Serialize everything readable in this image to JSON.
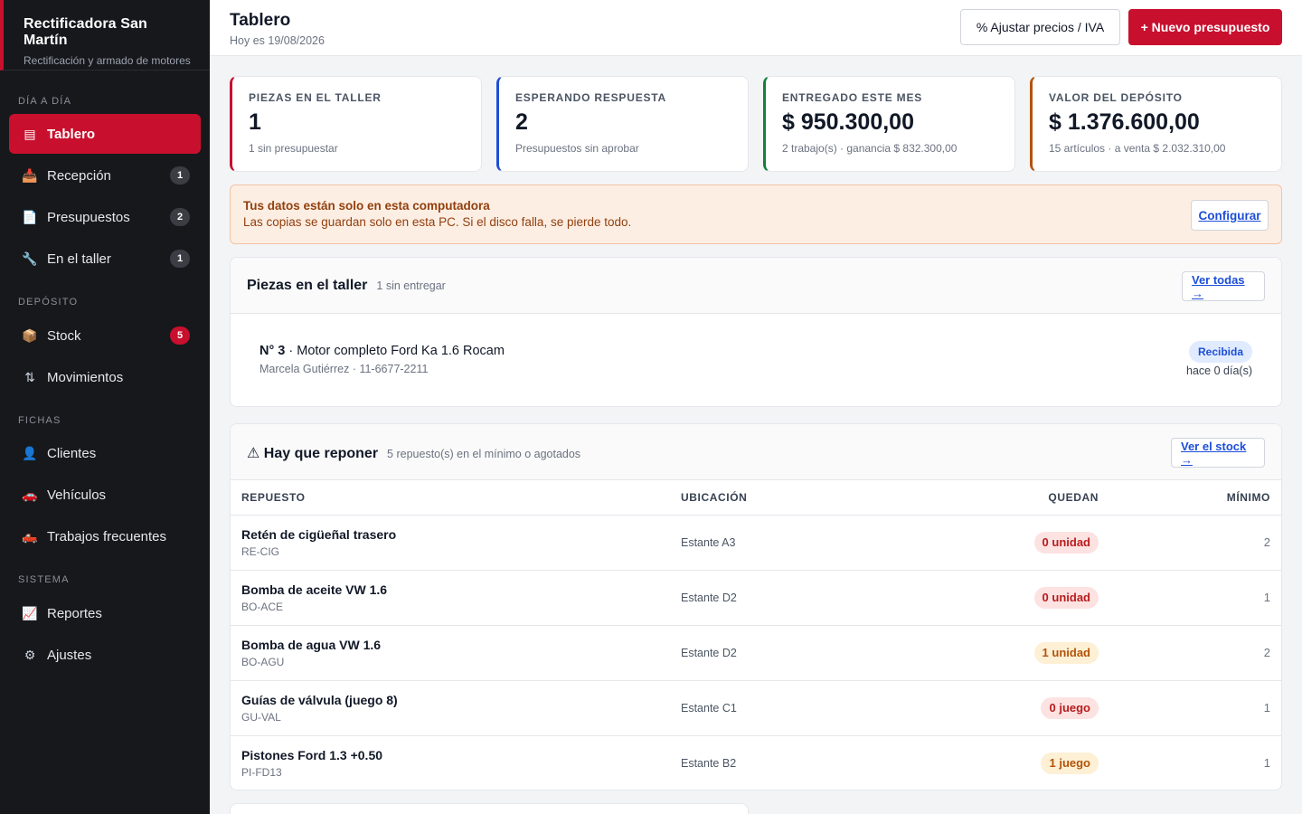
{
  "app": {
    "name": "Rectificadora San Martín",
    "tagline": "Rectificación y armado de motores"
  },
  "sidebar": {
    "sections": [
      {
        "label": "Día a día"
      },
      {
        "label": "Depósito"
      },
      {
        "label": "Fichas"
      },
      {
        "label": "Sistema"
      }
    ],
    "items": [
      {
        "label": "Tablero",
        "icon": "dashboard-icon",
        "glyph": "▤",
        "active": true
      },
      {
        "label": "Recepción",
        "icon": "inbox-icon",
        "glyph": "📥",
        "badge": "1"
      },
      {
        "label": "Presupuestos",
        "icon": "document-icon",
        "glyph": "📄",
        "badge": "2"
      },
      {
        "label": "En el taller",
        "icon": "wrench-icon",
        "glyph": "🔧",
        "badge": "1"
      },
      {
        "label": "Stock",
        "icon": "box-icon",
        "glyph": "📦",
        "badge": "5"
      },
      {
        "label": "Movimientos",
        "icon": "swap-icon",
        "glyph": "⇅"
      },
      {
        "label": "Clientes",
        "icon": "user-icon",
        "glyph": "👤"
      },
      {
        "label": "Vehículos",
        "icon": "car-icon",
        "glyph": "🚗"
      },
      {
        "label": "Trabajos frecuentes",
        "icon": "truck-icon",
        "glyph": "🛻"
      },
      {
        "label": "Reportes",
        "icon": "chart-icon",
        "glyph": "📈"
      },
      {
        "label": "Ajustes",
        "icon": "gear-icon",
        "glyph": "⚙"
      }
    ]
  },
  "header": {
    "title": "Tablero",
    "date": "Hoy es 19/08/2026",
    "adjust_button": "% Ajustar precios / IVA",
    "new_button": "+ Nuevo presupuesto"
  },
  "stats": [
    {
      "label": "Piezas en el taller",
      "value": "1",
      "sub": "1 sin presupuestar",
      "color": "#c8102e"
    },
    {
      "label": "Esperando respuesta",
      "value": "2",
      "sub": "Presupuestos sin aprobar",
      "color": "#1d4ed8"
    },
    {
      "label": "Entregado este mes",
      "value": "$ 950.300,00",
      "sub": "2 trabajo(s) · ganancia $ 832.300,00",
      "color": "#15803d"
    },
    {
      "label": "Valor del depósito",
      "value": "$ 1.376.600,00",
      "sub": "15 artículos · a venta $ 2.032.310,00",
      "color": "#b45309"
    }
  ],
  "alert": {
    "title": "Tus datos están solo en esta computadora",
    "text": "Las copias se guardan solo en esta PC. Si el disco falla, se pierde todo.",
    "button": "Configurar"
  },
  "workshop": {
    "title": "Piezas en el taller",
    "meta": "1 sin entregar",
    "link": "Ver todas →",
    "jobs": [
      {
        "number": "N° 3",
        "description": " · Motor completo Ford Ka 1.6 Rocam",
        "client": "Marcela Gutiérrez · 11-6677-2211",
        "status": "Recibida",
        "age": "hace 0 día(s)"
      }
    ]
  },
  "restock": {
    "title": "⚠ Hay que reponer",
    "meta": "5 repuesto(s) en el mínimo o agotados",
    "link": "Ver el stock →",
    "columns": [
      "Repuesto",
      "Ubicación",
      "Quedan",
      "Mínimo"
    ],
    "rows": [
      {
        "name": "Retén de cigüeñal trasero",
        "code": "RE-CIG",
        "location": "Estante A3",
        "left": "0 unidad",
        "level": "red",
        "min": "2"
      },
      {
        "name": "Bomba de aceite VW 1.6",
        "code": "BO-ACE",
        "location": "Estante D2",
        "left": "0 unidad",
        "level": "red",
        "min": "1"
      },
      {
        "name": "Bomba de agua VW 1.6",
        "code": "BO-AGU",
        "location": "Estante D2",
        "left": "1 unidad",
        "level": "amber",
        "min": "2"
      },
      {
        "name": "Guías de válvula (juego 8)",
        "code": "GU-VAL",
        "location": "Estante C1",
        "left": "0 juego",
        "level": "red",
        "min": "1"
      },
      {
        "name": "Pistones Ford 1.3 +0.50",
        "code": "PI-FD13",
        "location": "Estante B2",
        "left": "1 juego",
        "level": "amber",
        "min": "1"
      }
    ]
  }
}
